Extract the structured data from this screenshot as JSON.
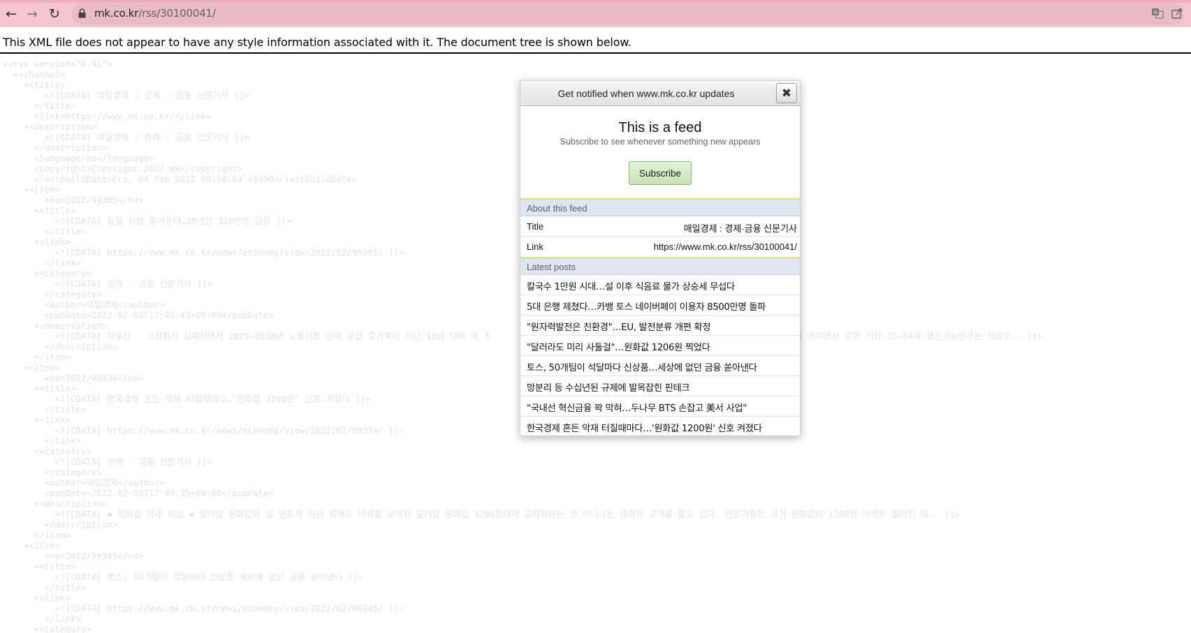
{
  "browser": {
    "url_host": "mk.co.kr",
    "url_path": "/rss/30100041/"
  },
  "xml_viewer": {
    "notice": "This XML file does not appear to have any style information associated with it. The document tree is shown below.",
    "lines": [
      "▾<rss version=\"0.91\">",
      "  ▾<channel>",
      "    ▾<title>",
      "        <![CDATA[ 매일경제 : 경제 · 금융 신문기사 ]]>",
      "      </title>",
      "      <link>https://www.mk.co.kr/</link>",
      "    ▾<description>",
      "        <![CDATA[ 매일경제 : 경제 · 금융 신문기사 ]]>",
      "      </description>",
      "      <language>ko</language>",
      "      <copyright>Copyright 2022 mk</copyright>",
      "      <lastBuildDate>Fri, 04 Feb 2022 00:50:04 +0900</lastBuildDate>",
      "    ▾<item>",
      "        <no>2022/99305</no>",
      "      ▾<title>",
      "          <![CDATA[ 일할 사람 줄어든다…10년간 320만명 급감 ]]>",
      "        </title>",
      "      ▾<link>",
      "          <![CDATA[ https://www.mk.co.kr/news/economy/view/2022/02/99305/ ]]>",
      "        </link>",
      "      ▾<category>",
      "          <![CDATA[ 경제 · 금융 신문기사 ]]>",
      "        </category>",
      "        <author>매일경제</author>",
      "        <pubDate>2022-02-03T17:43:43+09:00</pubDate>",
      "      ▾<description>",
      "          <![CDATA[ 저출산 · 고령화가 심해지면서 2020~2030년 노동시장 인력 공급 증가폭이 지난 10년 대비 약 3                                                         폭이 커지면서 같은 기간 15~64세 생산가능인구는 처음으.. ]]>",
      "        </description>",
      "      </item>",
      "    ▾<item>",
      "        <no>2022/99334</no>",
      "      ▾<title>",
      "          <![CDATA[ 한국경제 흔든 악재 터질때마다…'원화값 1200원' 신호 켜졌다 ]]>",
      "        </title>",
      "      ▾<link>",
      "          <![CDATA[ https://www.mk.co.kr/news/economy/view/2022/02/99334/ ]]>",
      "        </link>",
      "      ▾<category>",
      "          <![CDATA[ 경제 · 금융 신문기사 ]]>",
      "        </category>",
      "        <author>매일경제</author>",
      "        <pubDate>2022-02-03T17:48:35+09:00</pubDate>",
      "      ▾<description>",
      "          <![CDATA[ ◆ 원화값 약세 비상 ◆ 달러당 원화값이 설 연휴가 지난 뒤에도 약세를 보이자 달러당 원화값 1200원대가 고착화하는 것 아니냐는 염려가 고개를 들고 있다. 전문가들은 과거 원화값이 1200원 아래로 떨어진 때.. ]]>",
      "        </description>",
      "      </item>",
      "    ▾<item>",
      "        <no>2022/99345</no>",
      "      ▾<title>",
      "          <![CDATA[ 토스, 50개팀이 석달마다 신상품 세상에 없던 금융 쏟아낸다 ]]>",
      "        </title>",
      "      ▾<link>",
      "          <![CDATA[ https://www.mk.co.kr/news/economy/view/2022/02/99345/ ]]>",
      "        </link>",
      "      ▾<category>"
    ]
  },
  "popup": {
    "header": "Get notified when www.mk.co.kr updates",
    "title": "This is a feed",
    "subtitle": "Subscribe to see whenever something new appears",
    "subscribe_label": "Subscribe",
    "about_label": "About this feed",
    "info": [
      {
        "key": "Title",
        "value": "매일경제 : 경제·금융 신문기사"
      },
      {
        "key": "Link",
        "value": "https://www.mk.co.kr/rss/30100041/"
      }
    ],
    "latest_label": "Latest posts",
    "posts": [
      "칼국수 1만원 시대…설 이후 식음료 물가 상승세 무섭다",
      "5대 은행 제쳤다…카뱅 토스 네이버페이 이용자 8500만명 돌파",
      "\"원자력발전은 친환경\"…EU, 발전분류 개편 확정",
      "\"달러라도 미리 사둘걸\"…원화값 1206원 찍었다",
      "토스, 50개팀이 석달마다 신상품…세상에 없던 금융 쏟아낸다",
      "망분리 등 수십년된 규제에 발목잡힌 핀테크",
      "\"국내선 혁신금융 꽉 막혀…두나무 BTS 손잡고 美서 사업\"",
      "한국경제 흔든 악재 터질때마다…'원화값 1200원' 신호 켜졌다"
    ]
  }
}
